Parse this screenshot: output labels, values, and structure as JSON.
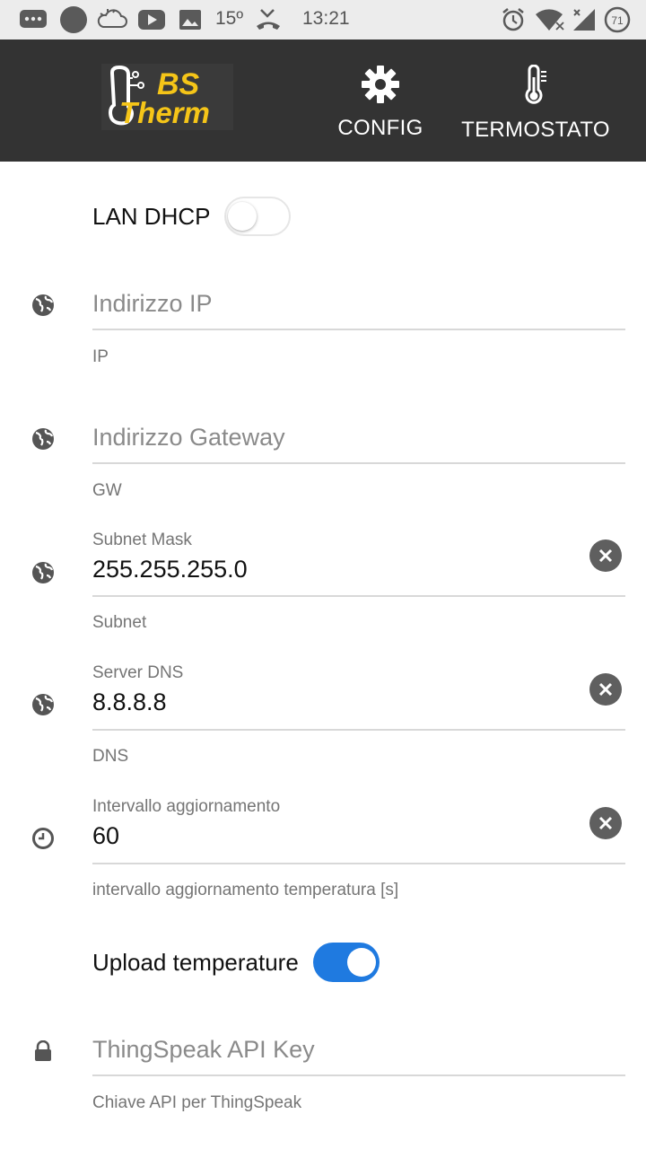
{
  "status_bar": {
    "temperature": "15º",
    "time": "13:21",
    "battery": "71"
  },
  "header": {
    "logo_line1": "BS",
    "logo_line2": "Therm",
    "nav": [
      {
        "label": "CONFIG",
        "icon": "gear-icon"
      },
      {
        "label": "TERMOSTATO",
        "icon": "thermometer-icon"
      }
    ]
  },
  "form": {
    "lan_dhcp": {
      "label": "LAN DHCP",
      "on": false
    },
    "ip": {
      "placeholder": "Indirizzo IP",
      "help": "IP",
      "icon": "globe-icon"
    },
    "gateway": {
      "placeholder": "Indirizzo Gateway",
      "help": "GW",
      "icon": "globe-icon"
    },
    "subnet": {
      "label": "Subnet Mask",
      "value": "255.255.255.0",
      "help": "Subnet",
      "icon": "globe-icon"
    },
    "dns": {
      "label": "Server DNS",
      "value": "8.8.8.8",
      "help": "DNS",
      "icon": "globe-icon"
    },
    "interval": {
      "label": "Intervallo aggiornamento",
      "value": "60",
      "help": "intervallo aggiornamento temperatura [s]",
      "icon": "clock-icon"
    },
    "upload": {
      "label": "Upload temperature",
      "on": true
    },
    "api_key": {
      "placeholder": "ThingSpeak API Key",
      "help": "Chiave API per ThingSpeak",
      "icon": "lock-icon"
    }
  },
  "colors": {
    "appbar": "#333333",
    "statusbar": "#ececec",
    "accent": "#1f7ae0",
    "logo": "#f5c518"
  }
}
